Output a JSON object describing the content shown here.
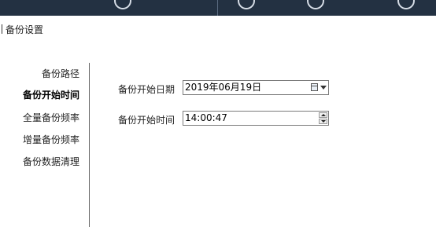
{
  "breadcrumb": {
    "title": "备份设置"
  },
  "sidebar": {
    "items": [
      {
        "label": "备份路径",
        "active": false
      },
      {
        "label": "备份开始时间",
        "active": true
      },
      {
        "label": "全量备份频率",
        "active": false
      },
      {
        "label": "增量备份频率",
        "active": false
      },
      {
        "label": "备份数据清理",
        "active": false
      }
    ]
  },
  "form": {
    "start_date": {
      "label": "备份开始日期",
      "value": "2019年06月19日",
      "button_icon": "calendar-icon"
    },
    "start_time": {
      "label": "备份开始时间",
      "value": "14:00:47"
    }
  }
}
